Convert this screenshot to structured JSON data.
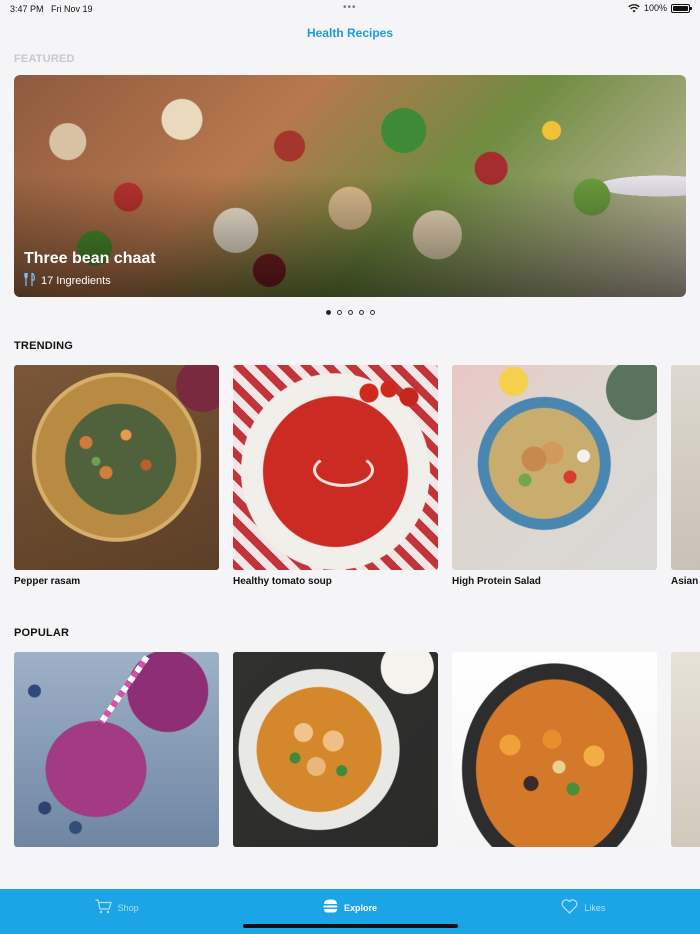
{
  "status_bar": {
    "time": "3:47 PM",
    "date": "Fri Nov 19",
    "battery": "100%"
  },
  "nav": {
    "title": "Health Recipes"
  },
  "featured": {
    "label": "FEATURED",
    "title": "Three bean chaat",
    "ingredients": "17 Ingredients",
    "page_count": 5,
    "active_page": 1
  },
  "trending": {
    "label": "TRENDING",
    "items": [
      {
        "title": "Pepper rasam"
      },
      {
        "title": "Healthy tomato soup"
      },
      {
        "title": "High Protein Salad"
      },
      {
        "title": "Asian s"
      }
    ]
  },
  "popular": {
    "label": "POPULAR"
  },
  "tabs": [
    {
      "label": "Shop",
      "icon": "cart-icon"
    },
    {
      "label": "Explore",
      "icon": "burger-icon"
    },
    {
      "label": "Likes",
      "icon": "heart-icon"
    }
  ],
  "colors": {
    "accent": "#1ba4e6",
    "title": "#1a9be0"
  }
}
